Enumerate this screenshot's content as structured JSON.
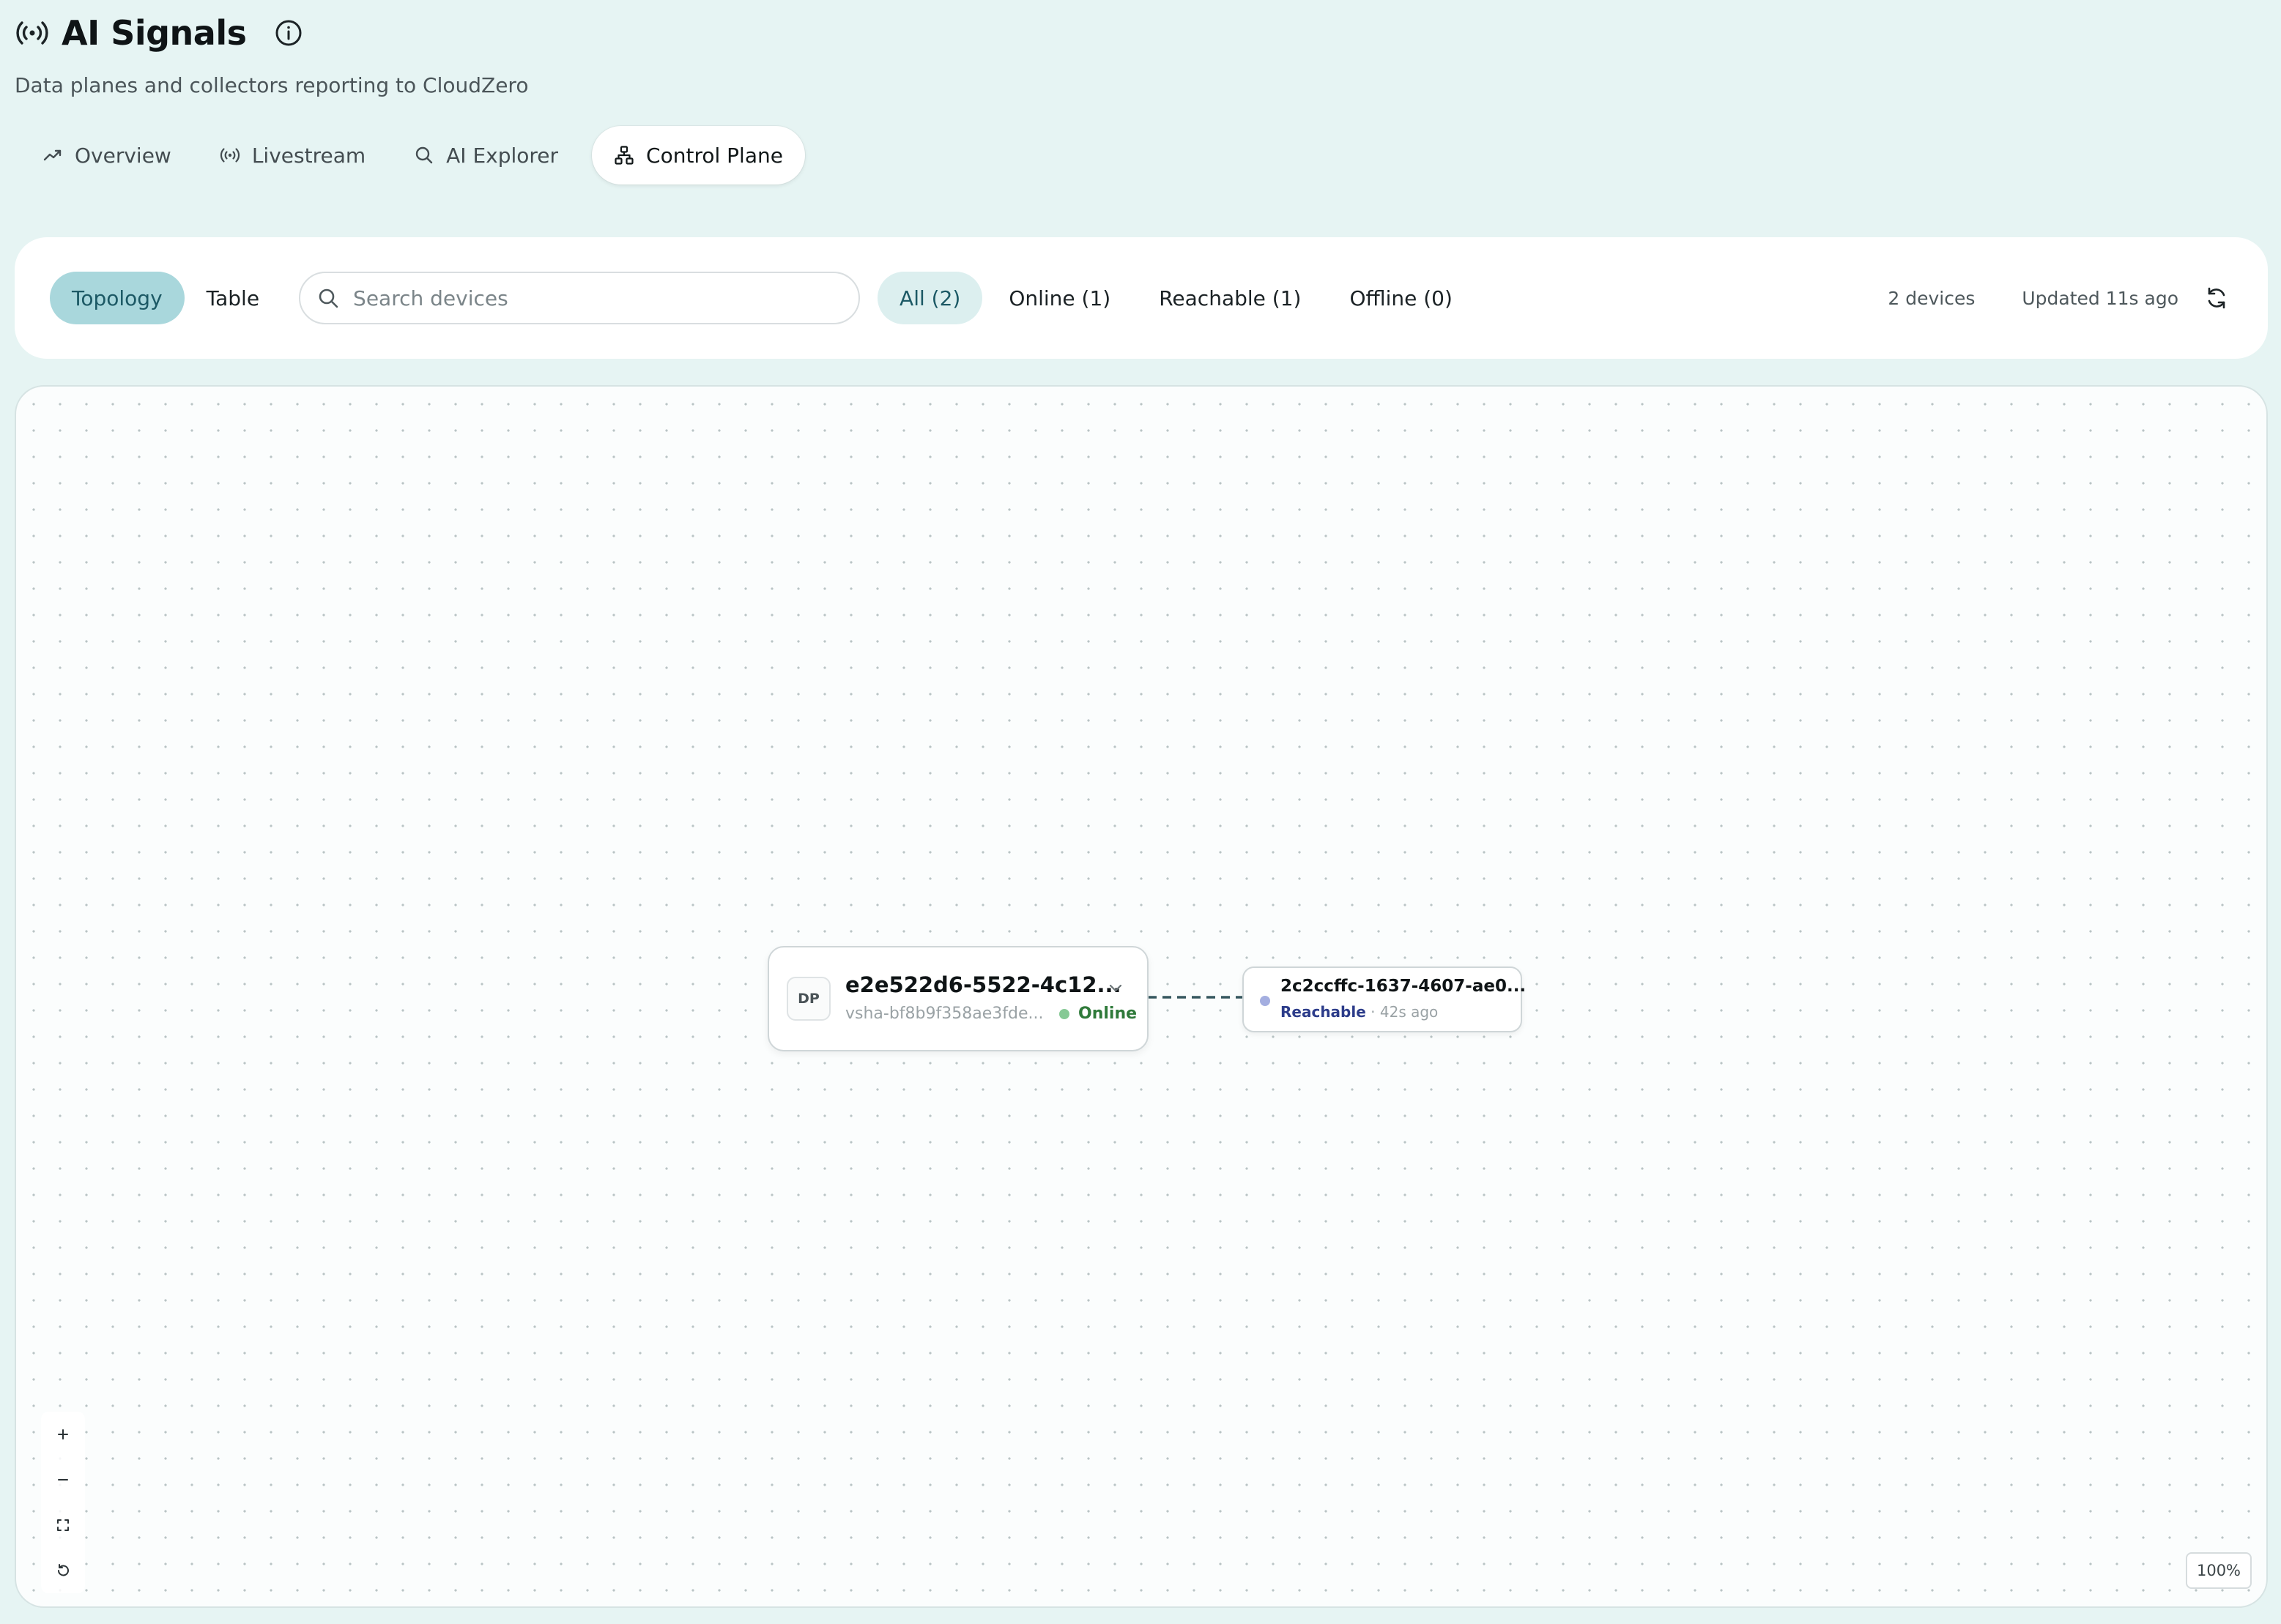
{
  "header": {
    "title": "AI Signals",
    "subtitle": "Data planes and collectors reporting to CloudZero",
    "app_icon": "signal-broadcast-icon",
    "info_icon": "info-icon"
  },
  "tabs": [
    {
      "label": "Overview",
      "icon": "trend-icon",
      "active": false
    },
    {
      "label": "Livestream",
      "icon": "broadcast-icon",
      "active": false
    },
    {
      "label": "AI Explorer",
      "icon": "search-icon",
      "active": false
    },
    {
      "label": "Control Plane",
      "icon": "network-icon",
      "active": true
    }
  ],
  "filterbar": {
    "views": [
      {
        "label": "Topology",
        "active": true
      },
      {
        "label": "Table",
        "active": false
      }
    ],
    "search": {
      "placeholder": "Search devices",
      "value": ""
    },
    "status_filters": [
      {
        "label": "All (2)",
        "active": true
      },
      {
        "label": "Online (1)",
        "active": false
      },
      {
        "label": "Reachable (1)",
        "active": false
      },
      {
        "label": "Offline (0)",
        "active": false
      }
    ],
    "device_count": "2 devices",
    "updated": "Updated 11s ago"
  },
  "topology": {
    "data_plane": {
      "badge": "DP",
      "name": "e2e522d6-5522-4c12...",
      "subtitle": "vsha-bf8b9f358ae3fde...",
      "status": "Online",
      "status_color": "#86c995"
    },
    "collector": {
      "name": "2c2ccffc-1637-4607-ae0...",
      "status": "Reachable",
      "separator": "·",
      "last_seen": "42s ago",
      "status_color": "#a4aee0"
    },
    "edge_style": "dashed",
    "zoom": "100%"
  },
  "colors": {
    "background": "#e6f4f3",
    "accent": "#a9d7dc",
    "online": "#2f7a3a",
    "reachable": "#2c3c8a"
  }
}
